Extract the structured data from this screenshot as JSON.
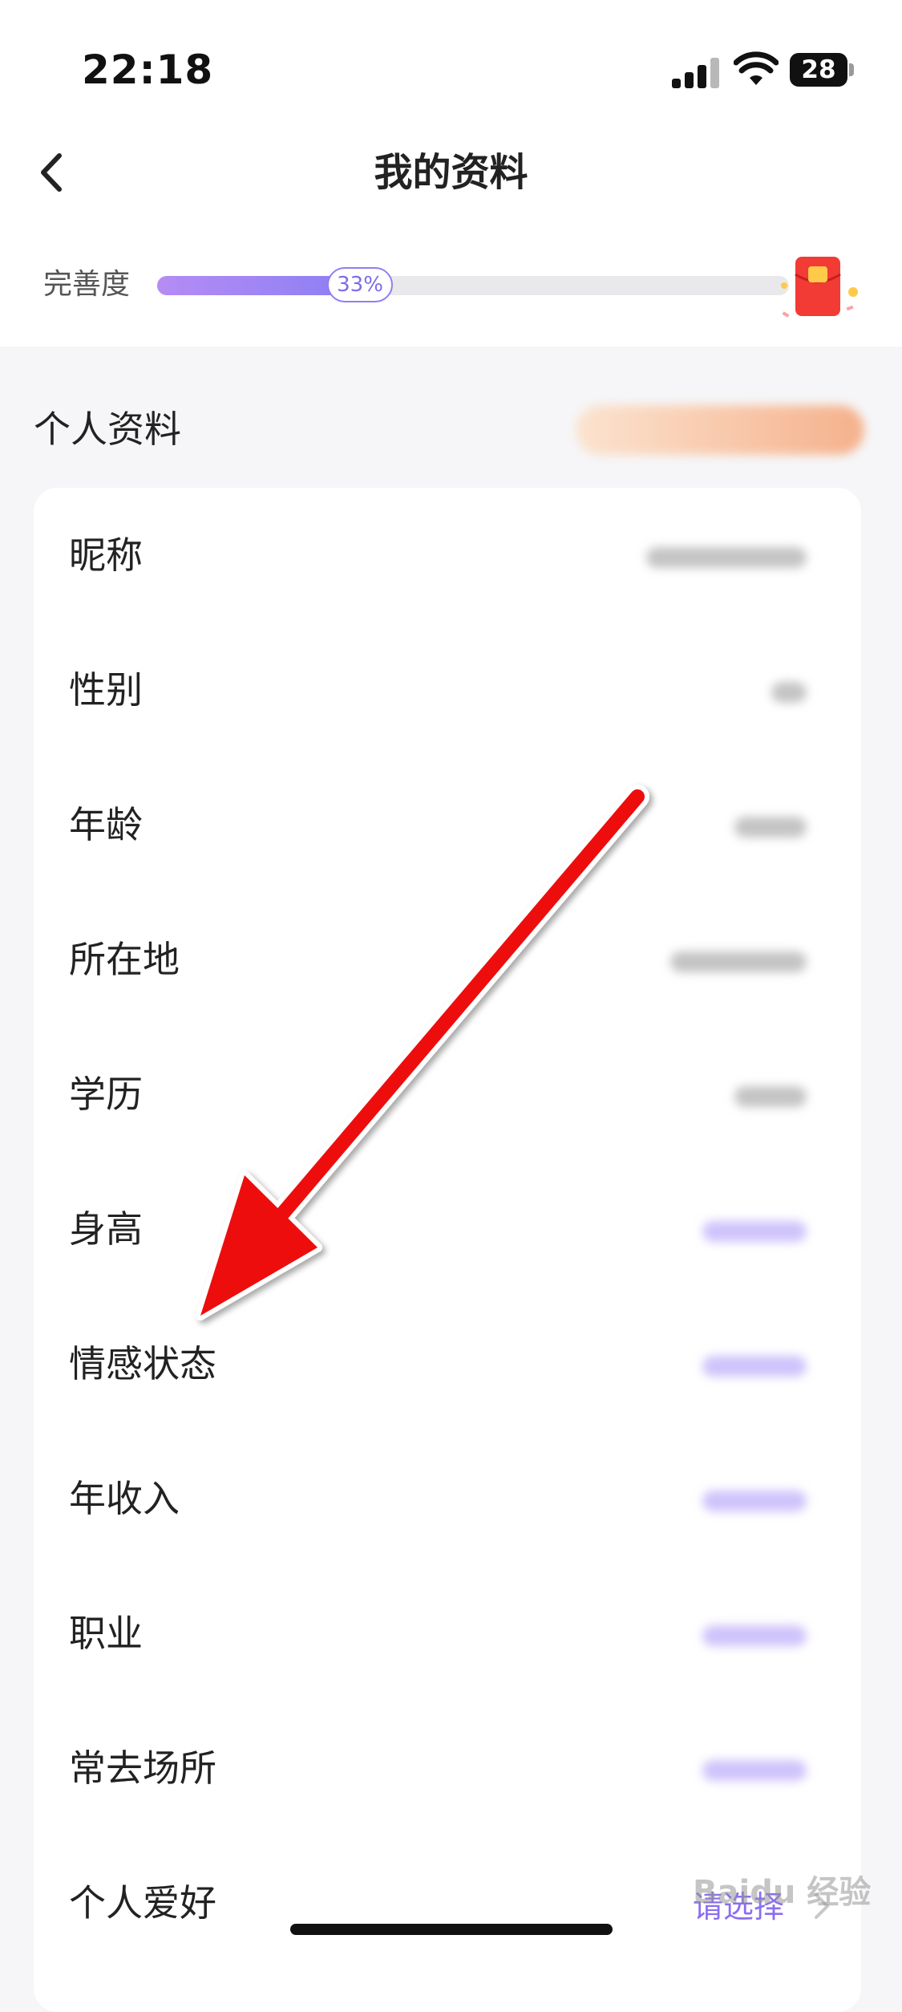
{
  "status_bar": {
    "time": "22:18",
    "battery": "28"
  },
  "nav": {
    "title": "我的资料"
  },
  "completion": {
    "label": "完善度",
    "percent_text": "33%",
    "percent": 33
  },
  "section": {
    "title": "个人资料"
  },
  "rows": [
    {
      "label": "昵称",
      "value_style": "gray"
    },
    {
      "label": "性别",
      "value_style": "gray"
    },
    {
      "label": "年龄",
      "value_style": "gray"
    },
    {
      "label": "所在地",
      "value_style": "gray"
    },
    {
      "label": "学历",
      "value_style": "gray"
    },
    {
      "label": "身高",
      "value_style": "purple"
    },
    {
      "label": "情感状态",
      "value_style": "purple"
    },
    {
      "label": "年收入",
      "value_style": "purple"
    },
    {
      "label": "职业",
      "value_style": "purple"
    },
    {
      "label": "常去场所",
      "value_style": "purple"
    },
    {
      "label": "个人爱好",
      "value_text": "请选择"
    }
  ],
  "watermark": "Baidu 经验",
  "colors": {
    "accent": "#8a6ef0",
    "arrow": "#ee1111"
  },
  "icons": [
    "back-chevron-icon",
    "signal-icon",
    "wifi-icon",
    "battery-icon",
    "red-envelope-icon",
    "chevron-right-icon"
  ]
}
